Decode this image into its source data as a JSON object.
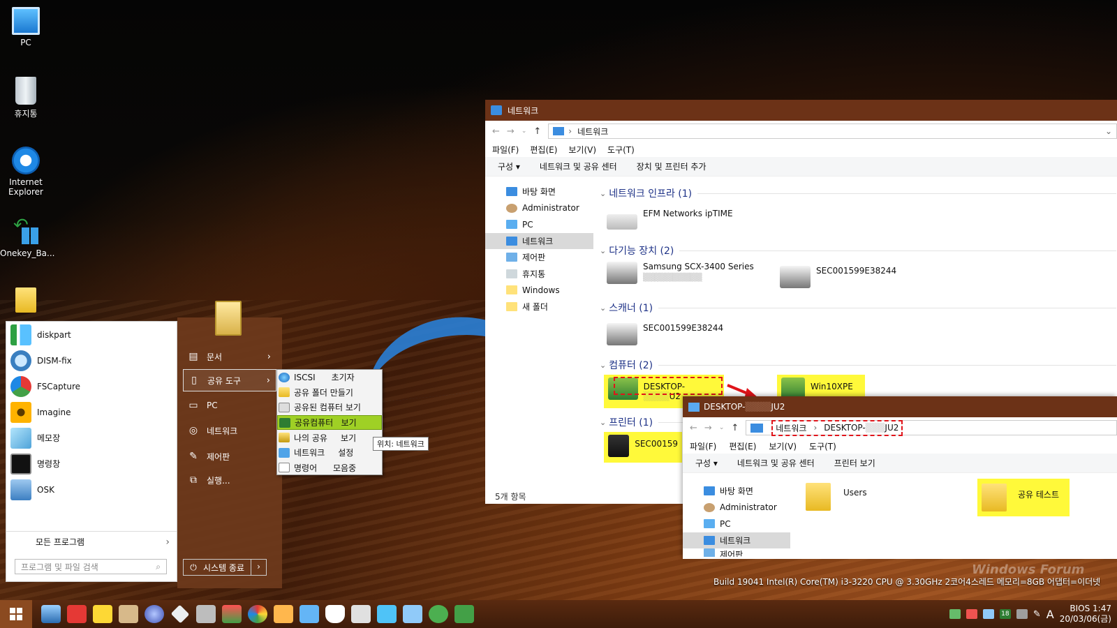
{
  "desktop": {
    "icons": [
      {
        "label": "PC"
      },
      {
        "label": "휴지통"
      },
      {
        "label": "Internet Explorer"
      },
      {
        "label": "Onekey_Ba..."
      }
    ]
  },
  "start_menu": {
    "programs": [
      {
        "label": "diskpart"
      },
      {
        "label": "DISM-fix"
      },
      {
        "label": "FSCapture"
      },
      {
        "label": "Imagine"
      },
      {
        "label": "메모장"
      },
      {
        "label": "명령창"
      },
      {
        "label": "OSK"
      }
    ],
    "all_programs": "모든 프로그램",
    "search_placeholder": "프로그램 및 파일 검색",
    "right_items": [
      {
        "label": "문서"
      },
      {
        "label": "공유 도구"
      },
      {
        "label": "PC"
      },
      {
        "label": "네트워크"
      },
      {
        "label": "제어판"
      },
      {
        "label": "실행..."
      }
    ],
    "shutdown_label": "시스템 종료"
  },
  "submenu": {
    "items": [
      {
        "label": "ISCSI      초기자"
      },
      {
        "label": "공유 폴더 만들기"
      },
      {
        "label": "공유된 컴퓨터 보기"
      },
      {
        "label": "공유컴퓨터   보기"
      },
      {
        "label": "나의 공유     보기"
      },
      {
        "label": "네트워크     설정"
      },
      {
        "label": "명령어      모음중"
      }
    ],
    "tooltip": "위치: 네트워크"
  },
  "explorer": {
    "title": "네트워크",
    "address": "네트워크",
    "menus": [
      "파일(F)",
      "편집(E)",
      "보기(V)",
      "도구(T)"
    ],
    "commands": [
      "구성 ▾",
      "네트워크 및 공유 센터",
      "장치 및 프린터 추가"
    ],
    "nav": [
      "바탕 화면",
      "Administrator",
      "PC",
      "네트워크",
      "제어판",
      "휴지통",
      "Windows",
      "새 폴더"
    ],
    "groups": [
      {
        "title": "네트워크 인프라 (1)"
      },
      {
        "title": "다기능 장치 (2)"
      },
      {
        "title": "스캐너 (1)"
      },
      {
        "title": "컴퓨터 (2)"
      },
      {
        "title": "프린터 (1)"
      }
    ],
    "devices": {
      "router": "EFM Networks ipTIME",
      "mfp1": "Samsung SCX-3400 Series",
      "mfp2": "SEC001599E38244",
      "scanner": "SEC001599E38244",
      "pc1": "DESKTOP-",
      "pc1_suffix": "U2",
      "pc2": "Win10XPE",
      "printer": "SEC00159"
    },
    "status": "5개 항목"
  },
  "explorer2": {
    "title": "DESKTOP-",
    "title_suffix": "JU2",
    "breadcrumb": [
      "네트워크",
      "DESKTOP-",
      "JU2"
    ],
    "menus": [
      "파일(F)",
      "편집(E)",
      "보기(V)",
      "도구(T)"
    ],
    "commands": [
      "구성 ▾",
      "네트워크 및 공유 센터",
      "프린터 보기"
    ],
    "nav": [
      "바탕 화면",
      "Administrator",
      "PC",
      "네트워크",
      "제어판"
    ],
    "folders": [
      "Users",
      "공유 테스트"
    ]
  },
  "sysinfo": "Build 19041    Intel(R) Core(TM) i3-3220 CPU @ 3.30GHz 2코어4스레드   메모리=8GB  어댑터=이더넷",
  "watermark": "Windows Forum",
  "taskbar": {
    "tray_badge": "18",
    "ime": "A",
    "clock_top": "BIOS  1:47",
    "clock_bottom": "20/03/06(금)"
  }
}
